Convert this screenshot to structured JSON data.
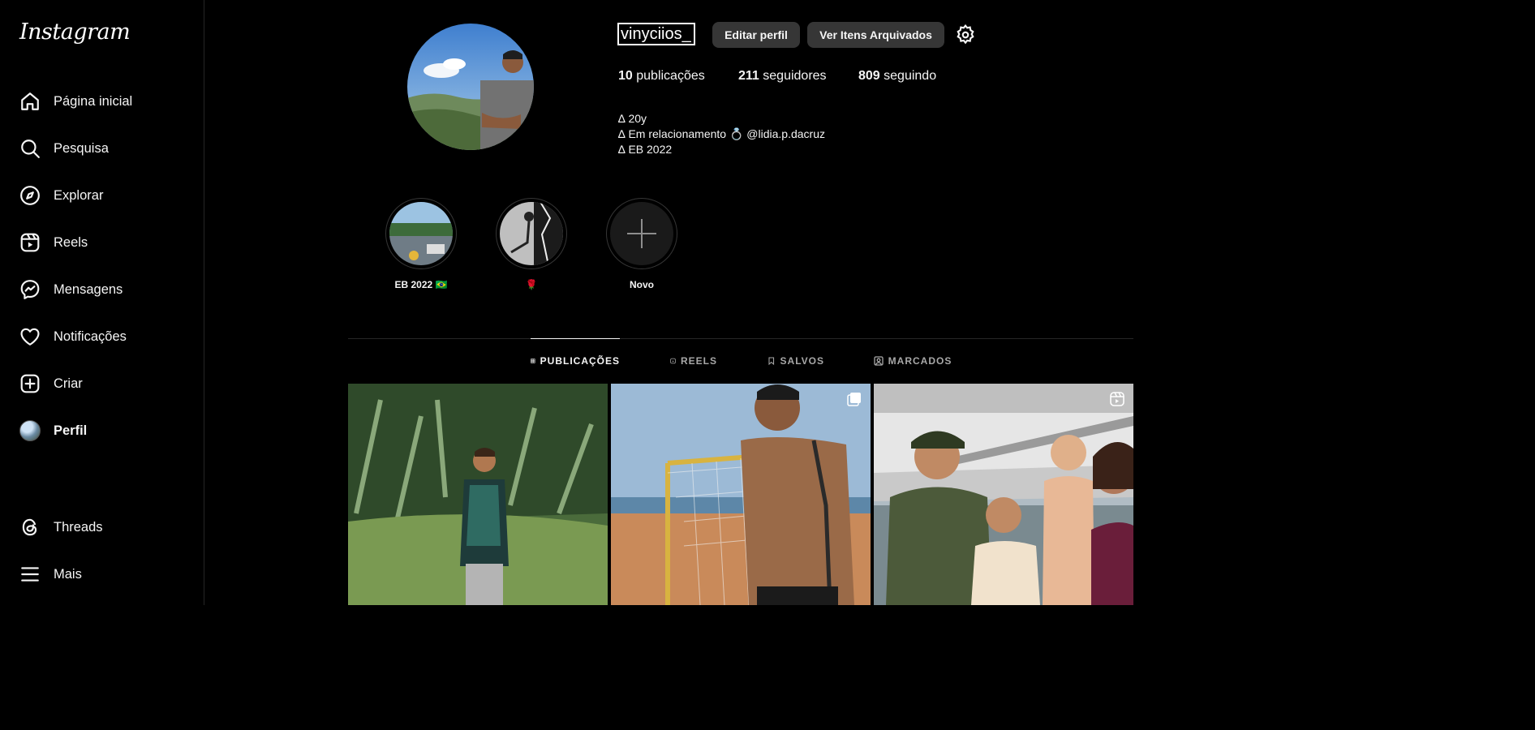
{
  "app": {
    "logo_text": "Instagram"
  },
  "sidebar": {
    "items": [
      {
        "label": "Página inicial",
        "icon": "home-icon"
      },
      {
        "label": "Pesquisa",
        "icon": "search-icon"
      },
      {
        "label": "Explorar",
        "icon": "compass-icon"
      },
      {
        "label": "Reels",
        "icon": "reels-icon"
      },
      {
        "label": "Mensagens",
        "icon": "messenger-icon"
      },
      {
        "label": "Notificações",
        "icon": "heart-icon"
      },
      {
        "label": "Criar",
        "icon": "plus-square-icon"
      },
      {
        "label": "Perfil",
        "icon": "avatar"
      }
    ],
    "bottom_items": [
      {
        "label": "Threads",
        "icon": "threads-icon"
      },
      {
        "label": "Mais",
        "icon": "menu-icon"
      }
    ]
  },
  "profile": {
    "username": "vinyciios_",
    "edit_button": "Editar perfil",
    "archive_button": "Ver Itens Arquivados",
    "stats": {
      "posts_count": "10",
      "posts_label": "publicações",
      "followers_count": "211",
      "followers_label": "seguidores",
      "following_count": "809",
      "following_label": "seguindo"
    },
    "bio": [
      "∆ 20y",
      "∆ Em relacionamento 💍 @lidia.p.dacruz",
      "∆ EB 2022"
    ]
  },
  "highlights": [
    {
      "label": "EB 2022 🇧🇷"
    },
    {
      "label": "🌹"
    },
    {
      "label": "Novo"
    }
  ],
  "tabs": [
    {
      "label": "PUBLICAÇÕES",
      "icon": "grid-icon",
      "active": true
    },
    {
      "label": "REELS",
      "icon": "reels-icon",
      "active": false
    },
    {
      "label": "SALVOS",
      "icon": "bookmark-icon",
      "active": false
    },
    {
      "label": "MARCADOS",
      "icon": "tagged-icon",
      "active": false
    }
  ],
  "colors": {
    "background": "#000000",
    "button": "#363636",
    "muted_text": "#a8a8a8",
    "divider": "#262626"
  }
}
